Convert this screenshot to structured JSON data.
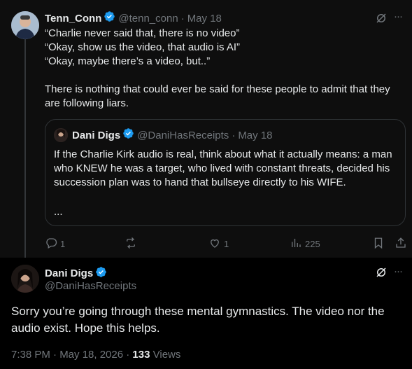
{
  "reply": {
    "author_name": "Tenn_Conn",
    "author_handle": "@tenn_conn",
    "dot": "·",
    "date": "May 18",
    "text": "“Charlie never said that, there is no video”\n“Okay, show us the video, that audio is AI”\n“Okay, maybe there’s a video, but..”\n\nThere is nothing that could ever be said for these people to admit that they are following liars.",
    "more_label": "···",
    "quote": {
      "author_name": "Dani Digs",
      "author_handle": "@DaniHasReceipts",
      "dot": "·",
      "date": "May 18",
      "text": "If the Charlie Kirk audio is real, think about what it actually means: a man who KNEW he was a target, who lived with constant threats, decided his succession plan was to hand that bullseye directly to his WIFE.",
      "ellipsis": "..."
    },
    "actions": {
      "reply_count": "1",
      "retweet_count": "",
      "like_count": "1",
      "view_count": "225"
    }
  },
  "main": {
    "author_name": "Dani Digs",
    "author_handle": "@DaniHasReceipts",
    "more_label": "···",
    "text": "Sorry you’re going through these mental gymnastics. The video nor the audio exist. Hope this helps.",
    "time": "7:38 PM · May 18, 2026 ·",
    "views_count": "133",
    "views_label": "Views"
  },
  "colors": {
    "verified": "#1d9bf0",
    "muted": "#71767b",
    "text": "#e7e9ea",
    "border": "#2f3336"
  },
  "icons": [
    "verified-badge-icon",
    "grok-icon",
    "more-icon",
    "reply-icon",
    "retweet-icon",
    "like-icon",
    "views-icon",
    "bookmark-icon",
    "share-icon"
  ]
}
